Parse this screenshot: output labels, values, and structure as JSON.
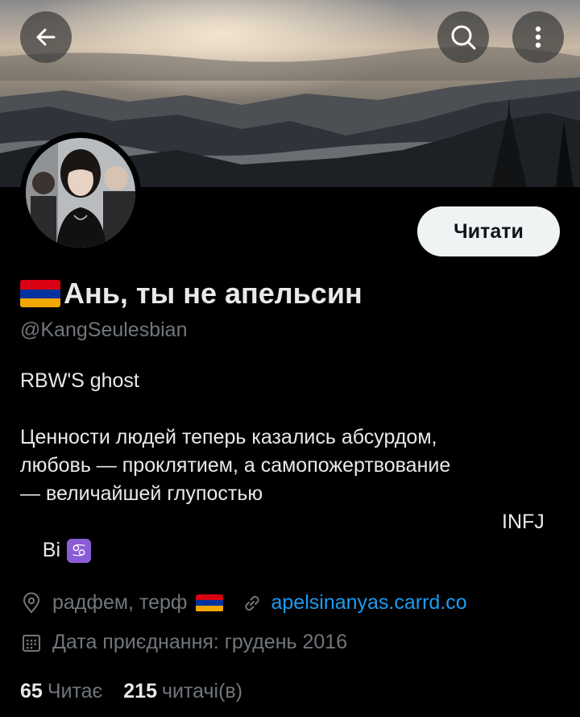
{
  "header": {
    "back_icon": "arrow-left-icon",
    "search_icon": "search-icon",
    "more_icon": "more-vertical-icon"
  },
  "profile": {
    "name": "Ань, ты не апельсин",
    "handle": "@KangSeulesbian",
    "follow_label": "Читати",
    "bio_line1": "RBW'S ghost",
    "bio_quote": "Ценности людей теперь казались абсурдом,\nлюбовь — проклятием, а самопожертвование\n— величайшей глупостью",
    "bio_tag": "INFJ",
    "bio_orientation": "Bi",
    "zodiac_symbol": "♋",
    "location": "радфем, терф",
    "website": "apelsinanyas.carrd.co",
    "joined": "Дата приєднання: грудень 2016",
    "following_count": "65",
    "following_label": "Читає",
    "followers_count": "215",
    "followers_label": "читачі(в)"
  },
  "colors": {
    "background": "#000000",
    "text_primary": "#e7e9ea",
    "text_secondary": "#71767b",
    "link": "#1d9bf0",
    "button_bg": "#eff3f4",
    "flag_red": "#d90012",
    "flag_blue": "#0033a0",
    "flag_orange": "#f2a800",
    "zodiac_bg": "#8a5cd6"
  }
}
